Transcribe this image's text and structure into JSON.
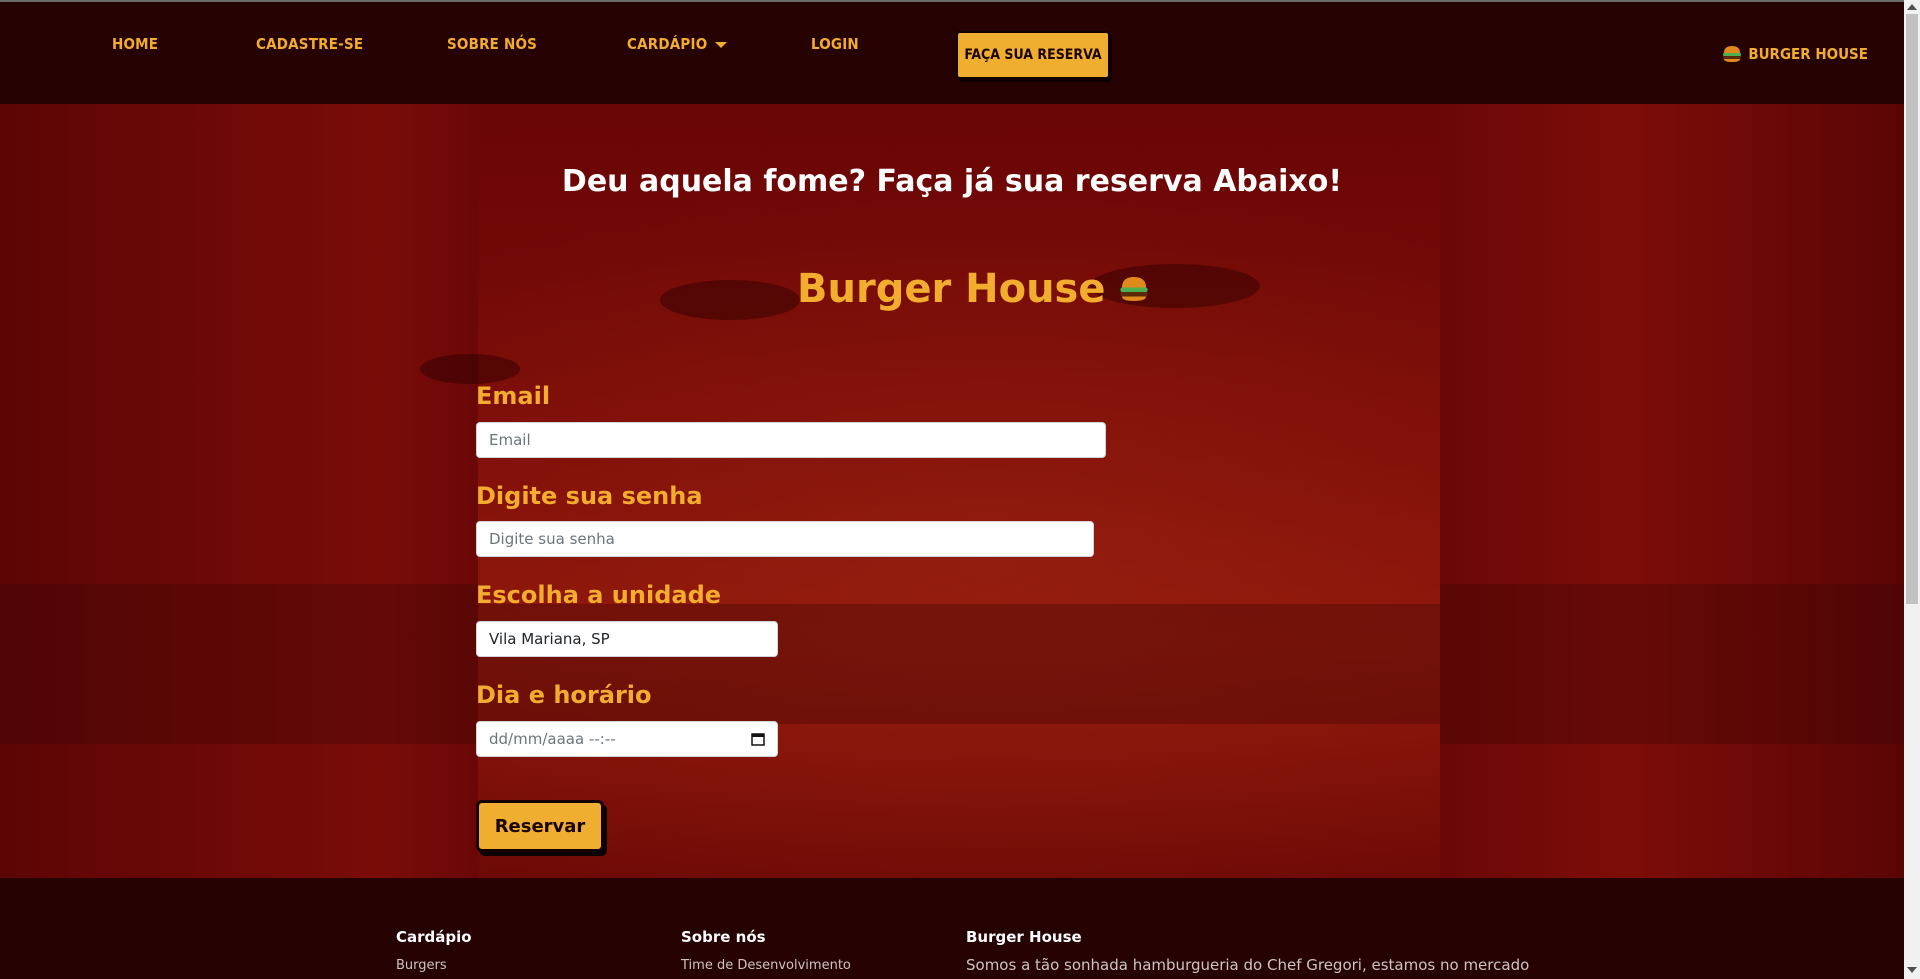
{
  "nav": {
    "items": [
      {
        "label": "Home"
      },
      {
        "label": "Cadastre-se"
      },
      {
        "label": "Sobre Nós"
      },
      {
        "label": "Cardápio"
      },
      {
        "label": "Login"
      }
    ],
    "reserve_button": "Faça sua reserva",
    "brand": "Burger House",
    "brand_icon": "burger-icon"
  },
  "hero": {
    "headline": "Deu aquela fome? Faça já sua reserva Abaixo!",
    "form_title": "Burger House",
    "form_title_icon": "burger-icon"
  },
  "form": {
    "email_label": "Email",
    "email_placeholder": "Email",
    "password_label": "Digite sua senha",
    "password_placeholder": "Digite sua senha",
    "unit_label": "Escolha a unidade",
    "unit_value": "Vila Mariana, SP",
    "datetime_label": "Dia e horário",
    "datetime_placeholder": "dd/mm/aaaa --:--",
    "submit_label": "Reservar"
  },
  "footer": {
    "col1": {
      "heading": "Cardápio",
      "link": "Burgers"
    },
    "col2": {
      "heading": "Sobre nós",
      "link": "Time de Desenvolvimento"
    },
    "col3": {
      "heading": "Burger House",
      "text": "Somos a tão sonhada hamburgueria do Chef Gregori, estamos no mercado"
    }
  },
  "colors": {
    "accent": "#f2ad2e",
    "nav_bg": "#260202",
    "hero_red": "#7a0b07"
  }
}
